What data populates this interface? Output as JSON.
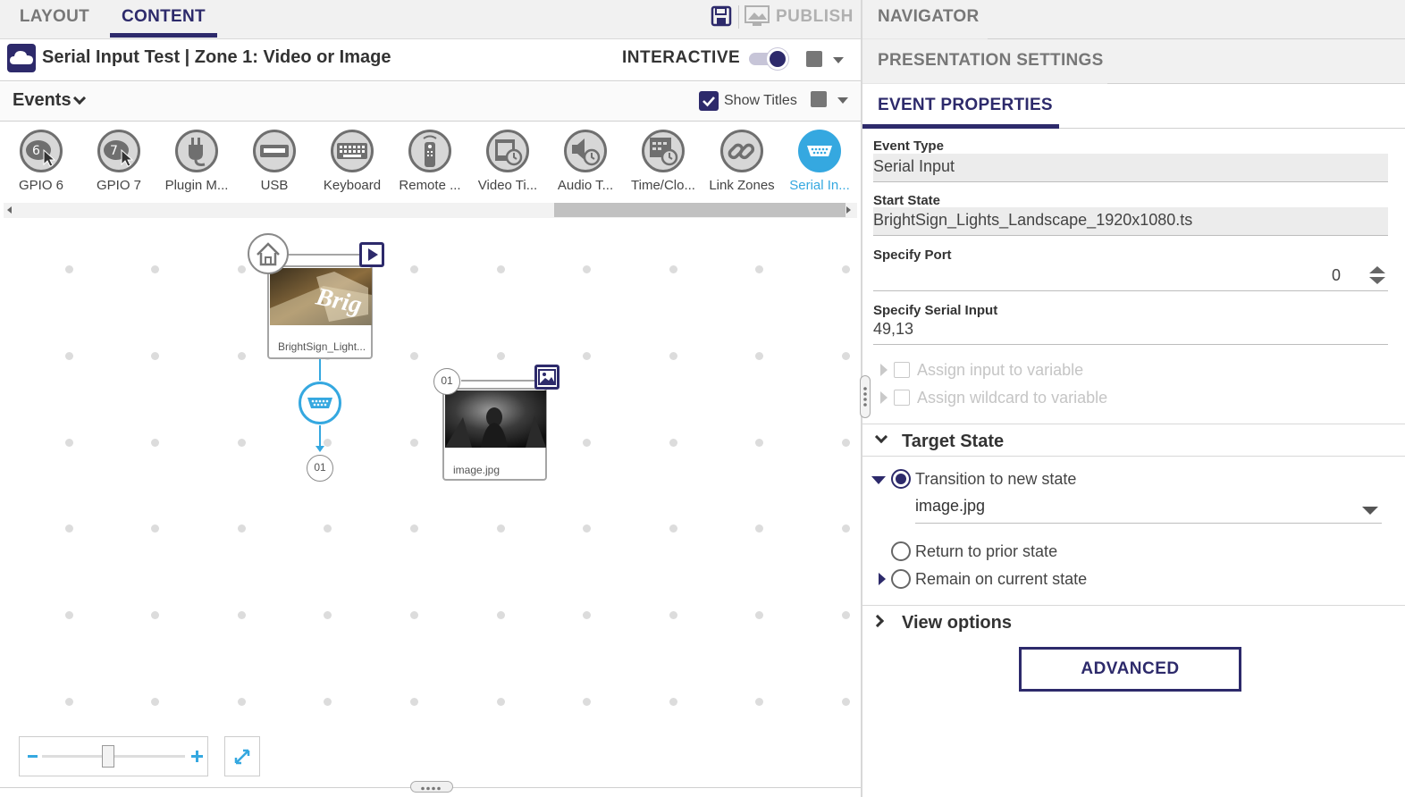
{
  "left_tabs": {
    "layout": "LAYOUT",
    "content": "CONTENT"
  },
  "toolbar": {
    "publish_label": "PUBLISH"
  },
  "zone": {
    "title": "Serial Input Test | Zone 1: Video or Image",
    "interactive_label": "INTERACTIVE"
  },
  "events_bar": {
    "title": "Events",
    "show_titles_label": "Show Titles"
  },
  "event_types": [
    {
      "label": "GPIO 6",
      "icon": "gpio-6-icon"
    },
    {
      "label": "GPIO 7",
      "icon": "gpio-7-icon"
    },
    {
      "label": "Plugin M...",
      "icon": "plugin-icon"
    },
    {
      "label": "USB",
      "icon": "usb-icon"
    },
    {
      "label": "Keyboard",
      "icon": "keyboard-icon"
    },
    {
      "label": "Remote ...",
      "icon": "remote-icon"
    },
    {
      "label": "Video Ti...",
      "icon": "video-timecode-icon"
    },
    {
      "label": "Audio T...",
      "icon": "audio-timecode-icon"
    },
    {
      "label": "Time/Clo...",
      "icon": "time-clock-icon"
    },
    {
      "label": "Link Zones",
      "icon": "link-icon"
    },
    {
      "label": "Serial In...",
      "icon": "serial-port-icon"
    }
  ],
  "canvas": {
    "state1": {
      "label": "BrightSign_Light..."
    },
    "state2": {
      "label": "image.jpg",
      "number": "01"
    },
    "event_target_number": "01"
  },
  "right_tabs": {
    "navigator": "NAVIGATOR",
    "presentation_settings": "PRESENTATION SETTINGS",
    "event_properties": "EVENT PROPERTIES"
  },
  "properties": {
    "event_type_label": "Event Type",
    "event_type_value": "Serial Input",
    "start_state_label": "Start State",
    "start_state_value": "BrightSign_Lights_Landscape_1920x1080.ts",
    "specify_port_label": "Specify Port",
    "specify_port_value": "0",
    "serial_input_label": "Specify Serial Input",
    "serial_input_value": "49,13",
    "assign_input_label": "Assign input to variable",
    "assign_wildcard_label": "Assign wildcard to variable"
  },
  "target_state": {
    "title": "Target State",
    "transition_label": "Transition to new state",
    "selected_state": "image.jpg",
    "return_prior_label": "Return to prior state",
    "remain_current_label": "Remain on current state"
  },
  "view_options": {
    "title": "View options"
  },
  "advanced_label": "ADVANCED",
  "colors": {
    "accent": "#2d2a6b",
    "event_blue": "#35a8e0"
  }
}
